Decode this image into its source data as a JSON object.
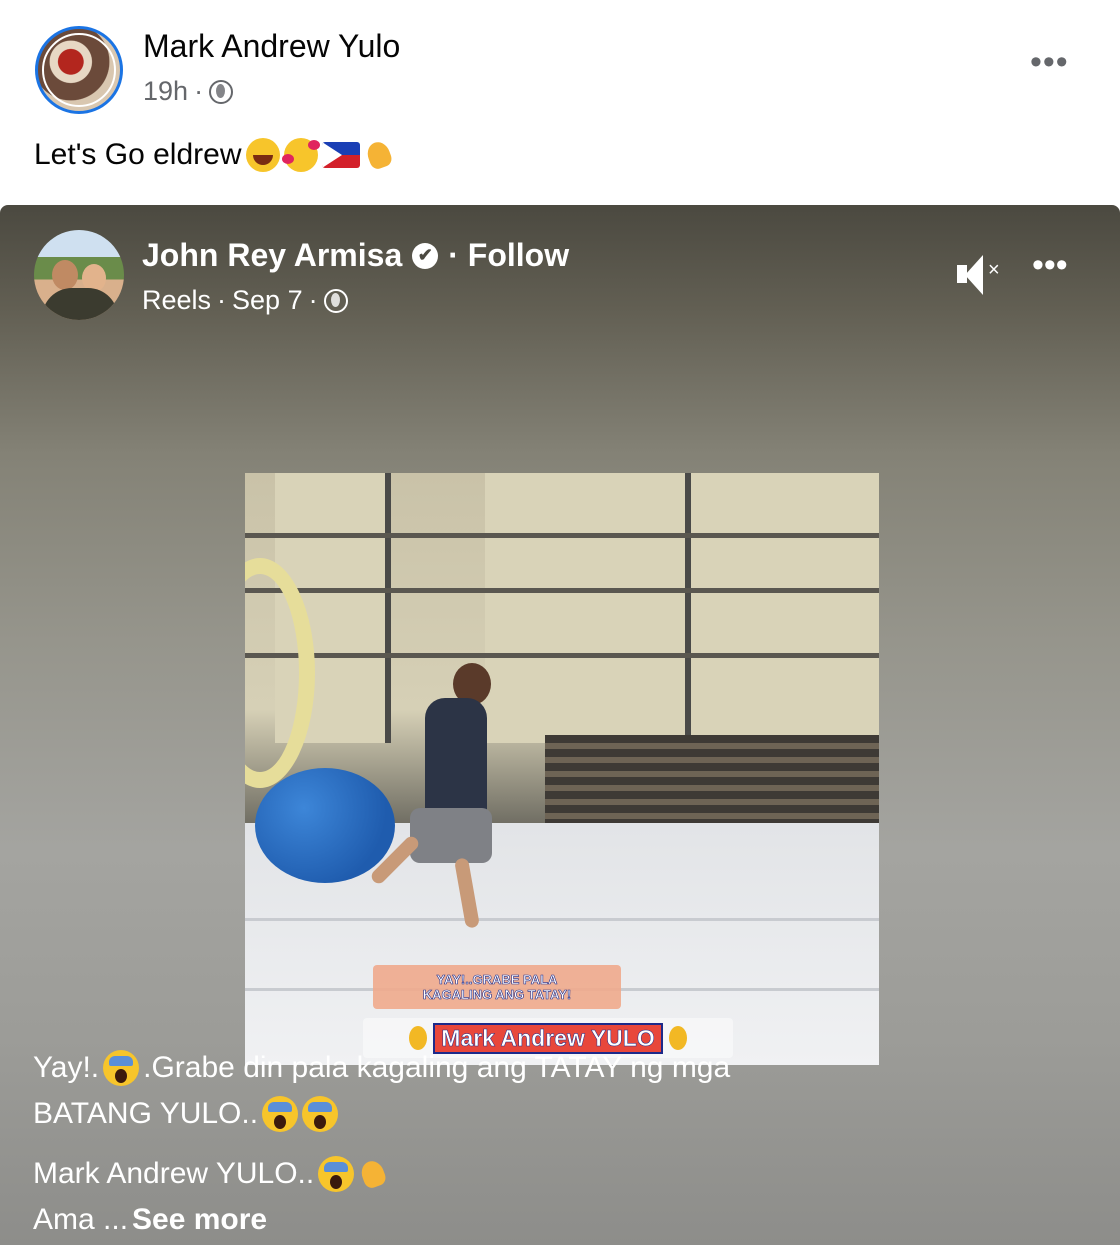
{
  "share_post": {
    "author": "Mark Andrew Yulo",
    "time": "19h",
    "caption": "Let's Go eldrew",
    "caption_emojis": [
      "laughing-emoji",
      "smiling-hearts-emoji",
      "philippines-flag-emoji",
      "flexed-biceps-emoji"
    ]
  },
  "reel": {
    "author": "John Rey Armisa",
    "verified": "✔",
    "follow": "· Follow",
    "type": "Reels",
    "date": "Sep 7",
    "video_overlay_1": "YAY!..GRABE PALA\nKAGALING ANG TATAY!",
    "video_overlay_2": "Mark Andrew YULO",
    "caption_line1": "Yay!.",
    "caption_line1b": ".Grabe din pala kagaling ang TATAY ng mga",
    "caption_line2": "BATANG YULO..",
    "caption_line3": "Mark Andrew YULO..",
    "caption_line4": "Ama ...",
    "see_more": "See more"
  },
  "icons": {
    "more": "•••",
    "mute": "×"
  },
  "colors": {
    "link_blue": "#1b74e4",
    "text_dark": "#050505",
    "text_muted": "#65676b"
  }
}
